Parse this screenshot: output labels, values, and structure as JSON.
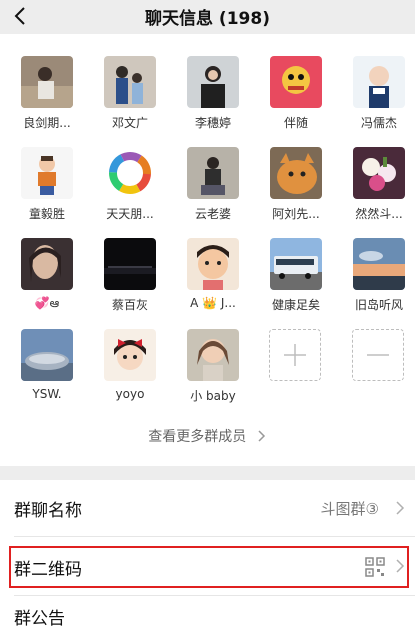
{
  "header": {
    "title": "聊天信息 (198)"
  },
  "members": [
    {
      "name": "良剑期..."
    },
    {
      "name": "邓文广"
    },
    {
      "name": "李穗婷"
    },
    {
      "name": "伴随"
    },
    {
      "name": "冯儒杰"
    },
    {
      "name": "童毅胜"
    },
    {
      "name": "天天朋..."
    },
    {
      "name": "云老婆"
    },
    {
      "name": "阿刘先..."
    },
    {
      "name": "然然斗..."
    },
    {
      "name": "💞ఆ"
    },
    {
      "name": "蔡百灰"
    },
    {
      "name": "A 👑 J..."
    },
    {
      "name": "健康足矣"
    },
    {
      "name": "旧岛听风"
    },
    {
      "name": "YSW."
    },
    {
      "name": "yoyo"
    },
    {
      "name": "小 baby"
    }
  ],
  "view_more": "查看更多群成员",
  "rows": {
    "group_name": {
      "label": "群聊名称",
      "value": "斗图群③"
    },
    "qr_code": {
      "label": "群二维码"
    },
    "announcement": {
      "label": "群公告"
    }
  },
  "colors": {
    "highlight": "#e02020",
    "separator": "#ededed"
  }
}
